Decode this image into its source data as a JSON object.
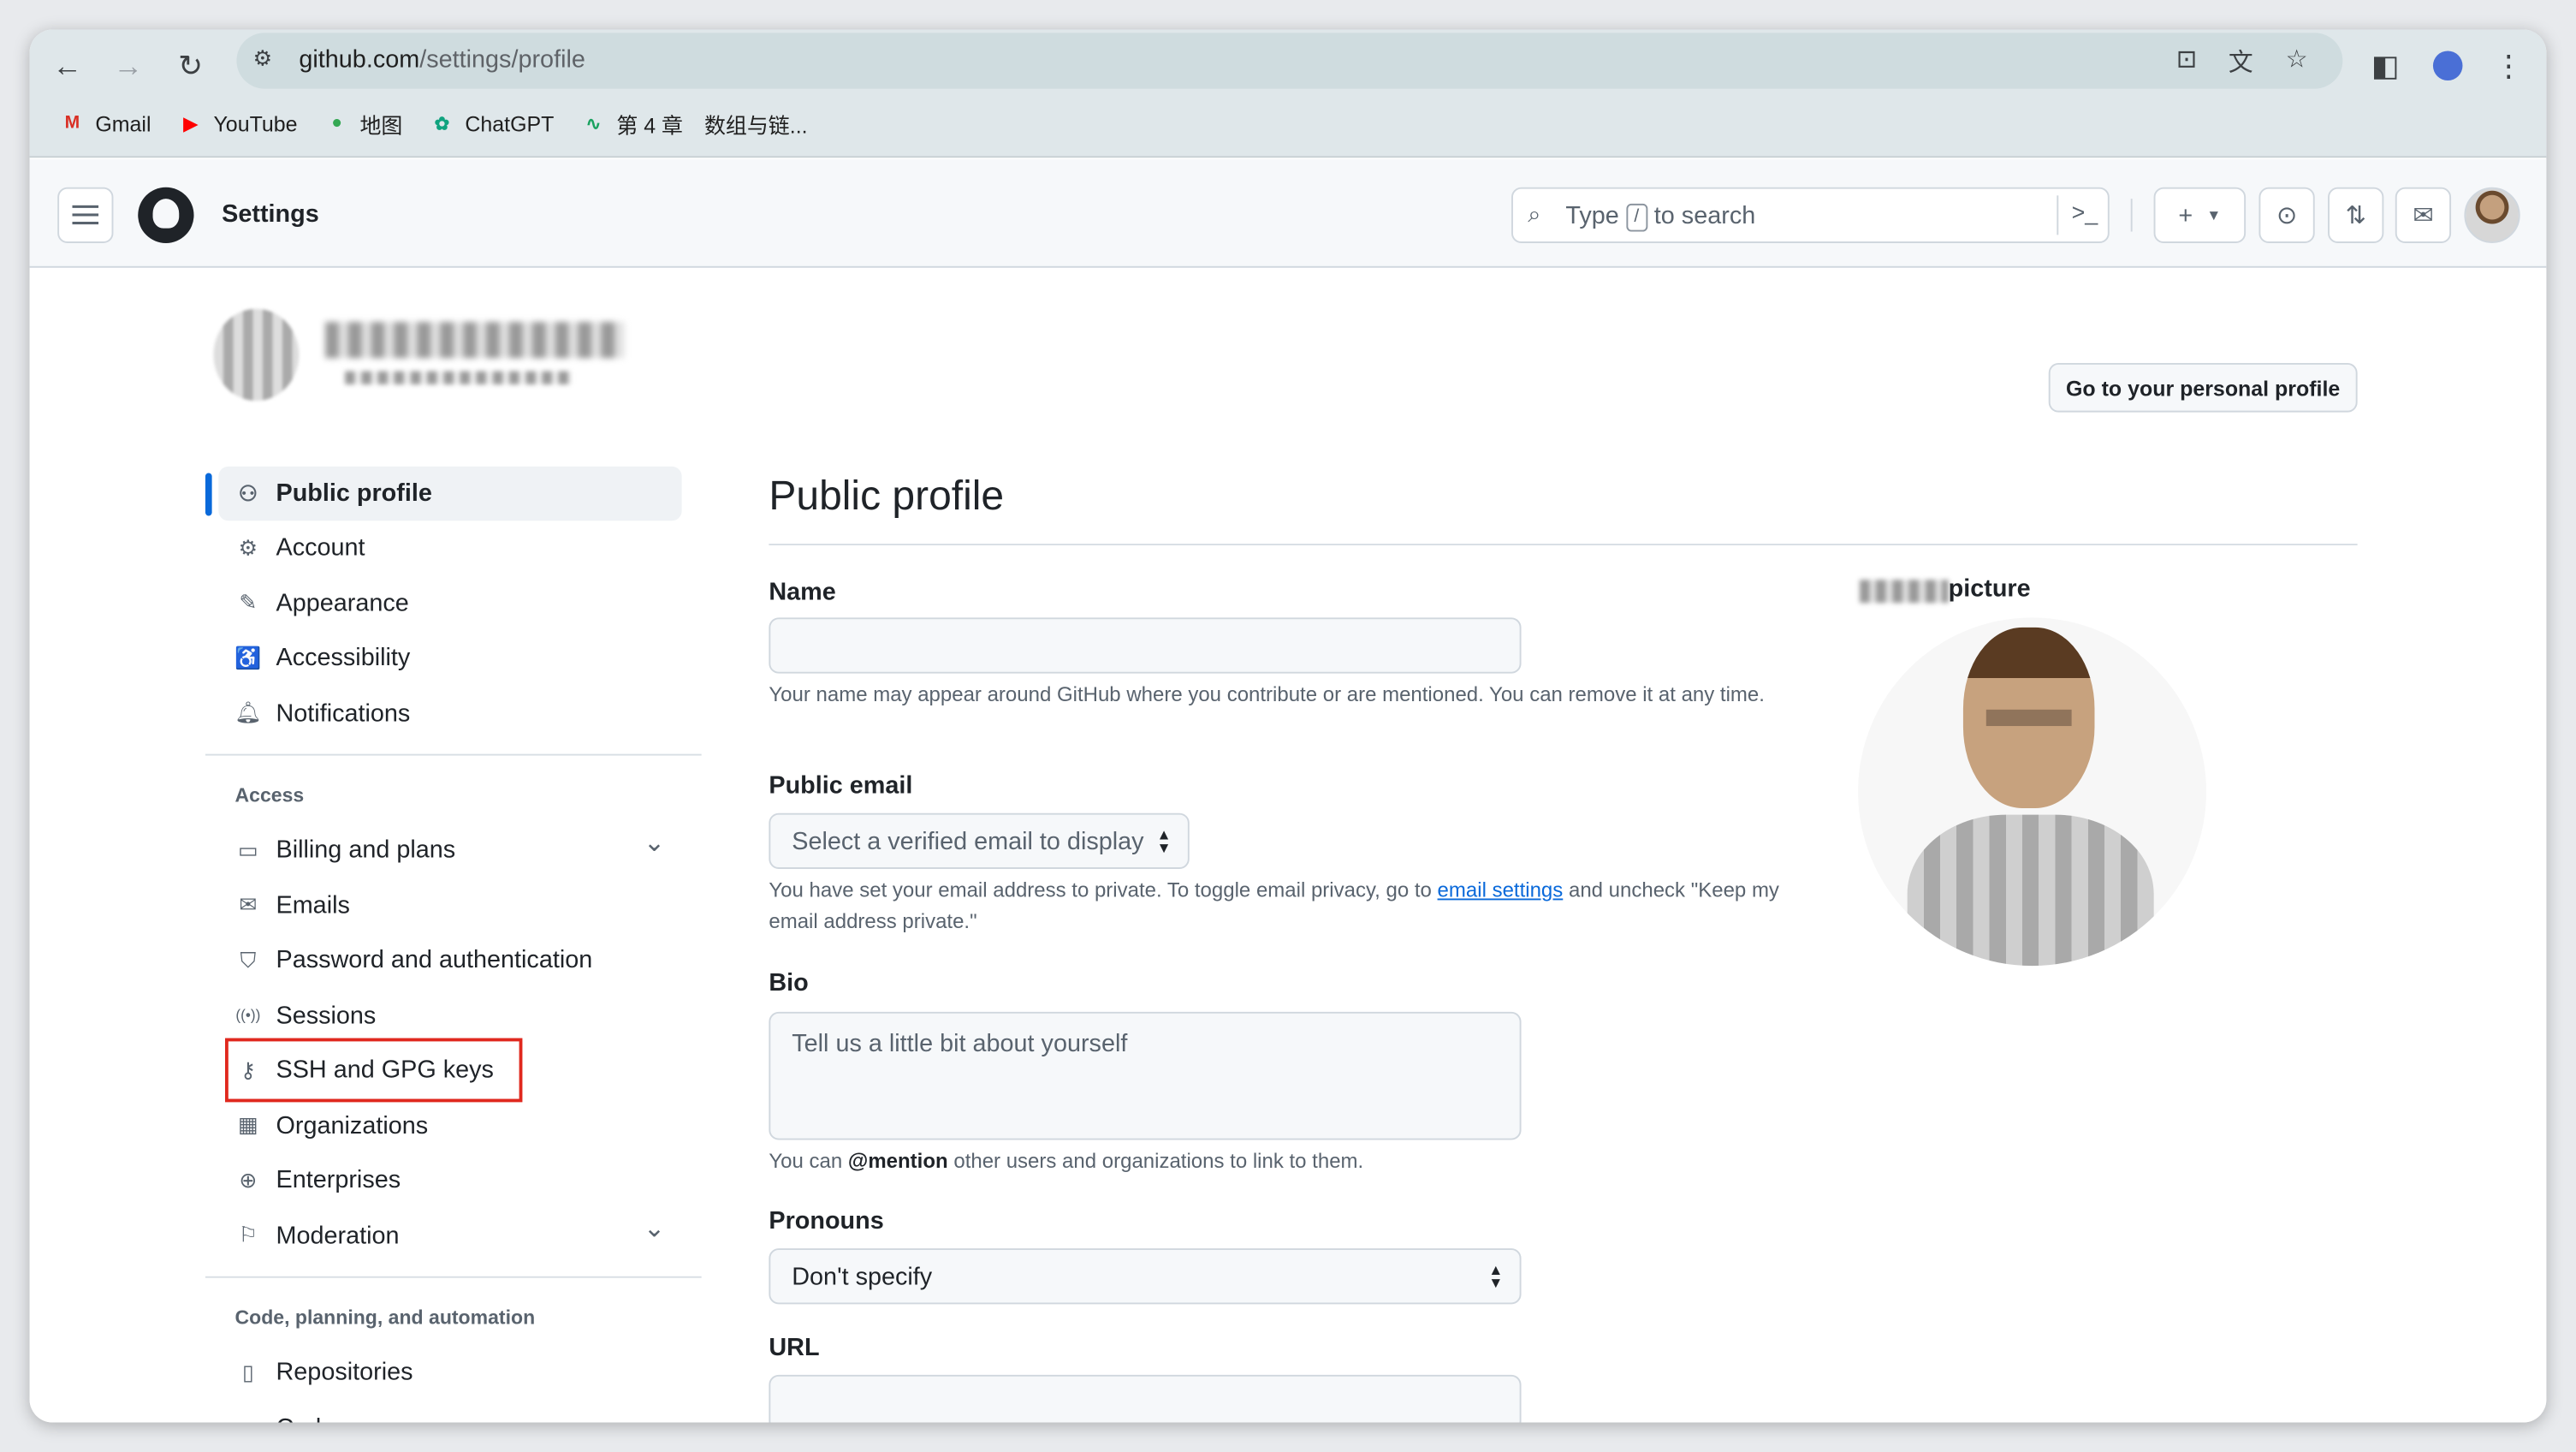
{
  "browser": {
    "url_host": "github.com",
    "url_path": "/settings/profile",
    "bookmarks": [
      {
        "label": "Gmail",
        "icon": "gmail-icon",
        "color": "#d93025"
      },
      {
        "label": "YouTube",
        "icon": "youtube-icon",
        "color": "#ff0000"
      },
      {
        "label": "地图",
        "icon": "maps-pin-icon",
        "color": "#34a853"
      },
      {
        "label": "ChatGPT",
        "icon": "chatgpt-icon",
        "color": "#10a37f"
      },
      {
        "label": "第 4 章　数组与链...",
        "icon": "chapter-icon",
        "color": "#1aa260"
      }
    ]
  },
  "header": {
    "title": "Settings",
    "search_prefix": "Type",
    "search_key": "/",
    "search_suffix": "to search"
  },
  "profile_link": "Go to your personal profile",
  "sidebar": {
    "top_items": [
      {
        "label": "Public profile",
        "icon": "person-icon",
        "active": true
      },
      {
        "label": "Account",
        "icon": "gear-icon"
      },
      {
        "label": "Appearance",
        "icon": "paintbrush-icon"
      },
      {
        "label": "Accessibility",
        "icon": "accessibility-icon"
      },
      {
        "label": "Notifications",
        "icon": "bell-icon"
      }
    ],
    "access_heading": "Access",
    "access_items": [
      {
        "label": "Billing and plans",
        "icon": "credit-card-icon",
        "expandable": true
      },
      {
        "label": "Emails",
        "icon": "mail-icon"
      },
      {
        "label": "Password and authentication",
        "icon": "shield-icon"
      },
      {
        "label": "Sessions",
        "icon": "broadcast-icon"
      },
      {
        "label": "SSH and GPG keys",
        "icon": "key-icon",
        "highlighted": true
      },
      {
        "label": "Organizations",
        "icon": "organization-icon"
      },
      {
        "label": "Enterprises",
        "icon": "globe-icon"
      },
      {
        "label": "Moderation",
        "icon": "report-icon",
        "expandable": true
      }
    ],
    "code_heading": "Code, planning, and automation",
    "code_items": [
      {
        "label": "Repositories",
        "icon": "repo-icon"
      },
      {
        "label": "Codespaces",
        "icon": "codespaces-icon"
      }
    ]
  },
  "main": {
    "title": "Public profile",
    "name_label": "Name",
    "name_value": "",
    "name_help": "Your name may appear around GitHub where you contribute or are mentioned. You can remove it at any time.",
    "email_label": "Public email",
    "email_select": "Select a verified email to display",
    "email_help_pre": "You have set your email address to private. To toggle email privacy, go to",
    "email_help_link": "email settings",
    "email_help_post": "and uncheck \"Keep my email address private.\"",
    "bio_label": "Bio",
    "bio_placeholder": "Tell us a little bit about yourself",
    "bio_help_pre": "You can",
    "bio_help_mention": "@mention",
    "bio_help_post": "other users and organizations to link to them.",
    "pronouns_label": "Pronouns",
    "pronouns_value": "Don't specify",
    "url_label": "URL",
    "url_value": "",
    "picture_label": "picture"
  },
  "colors": {
    "accent": "#0969da",
    "highlight_box": "#e0281e"
  }
}
